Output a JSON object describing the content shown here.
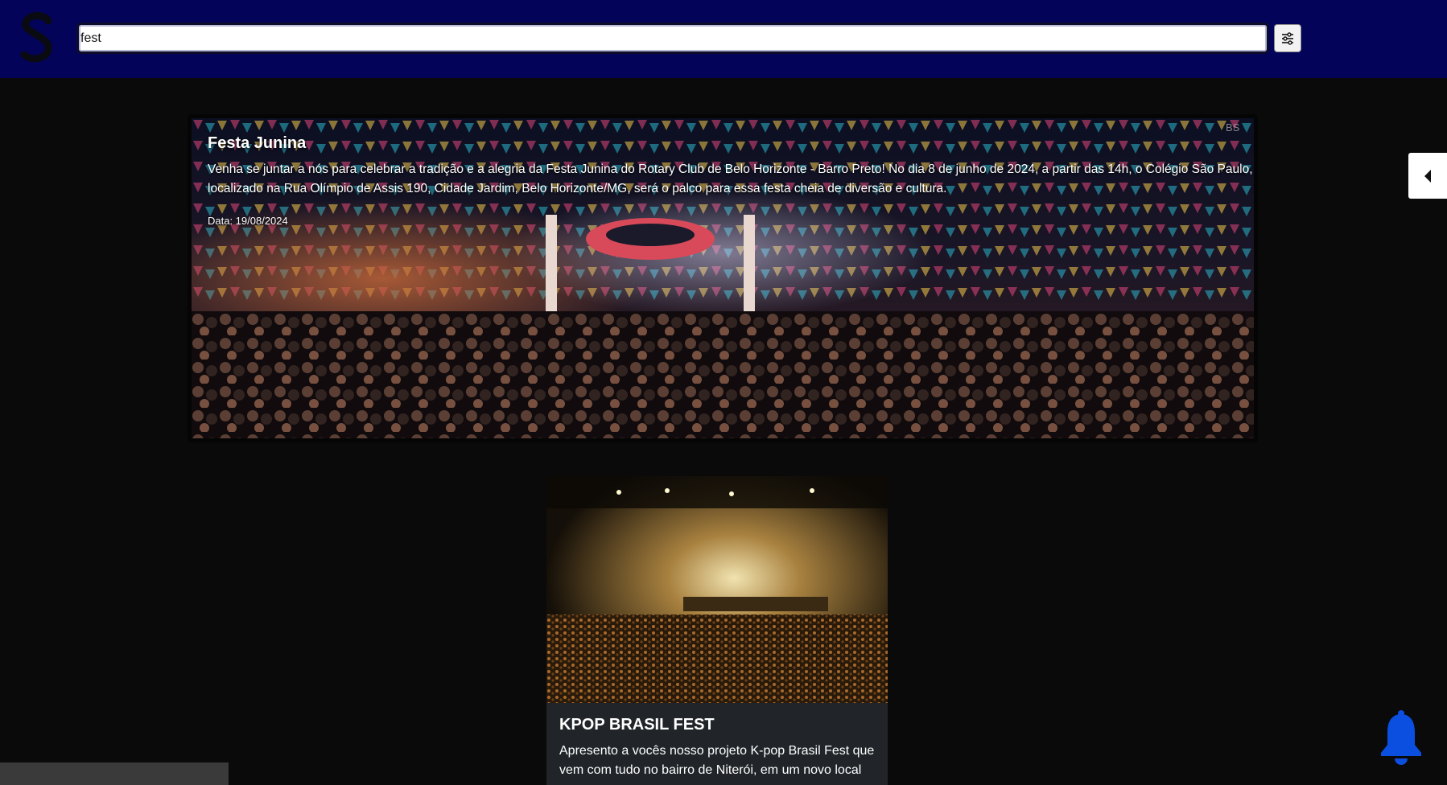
{
  "header": {
    "logo_icon": "s-logo-icon",
    "search": {
      "value": "fest",
      "placeholder": ""
    },
    "filter_icon": "sliders-icon"
  },
  "featured": {
    "title": "Festa Junina",
    "description": "Venha se juntar a nós para celebrar a tradição e a alegria da Festa Junina do Rotary Club de Belo Horizonte - Barro Preto! No dia 8 de junho de 2024, a partir das 14h, o Colégio São Paulo, localizado na Rua Olímpio de Assis 190, Cidade Jardim, Belo Horizonte/MG, será o palco para essa festa cheia de diversão e cultura.",
    "date": "Data: 19/08/2024",
    "watermark": "BS"
  },
  "side_toggle": {
    "icon": "caret-left-icon"
  },
  "events": [
    {
      "title": "KPOP BRASIL FEST",
      "description": "Apresento a vocês nosso projeto K-pop Brasil Fest que vem com tudo no bairro de Niterói, em um novo local"
    }
  ],
  "notifications": {
    "icon": "bell-icon",
    "color": "#0b4fe0"
  },
  "colors": {
    "header_bg": "#03035a",
    "page_bg": "#0a0a0a",
    "card_bg": "#212529"
  }
}
